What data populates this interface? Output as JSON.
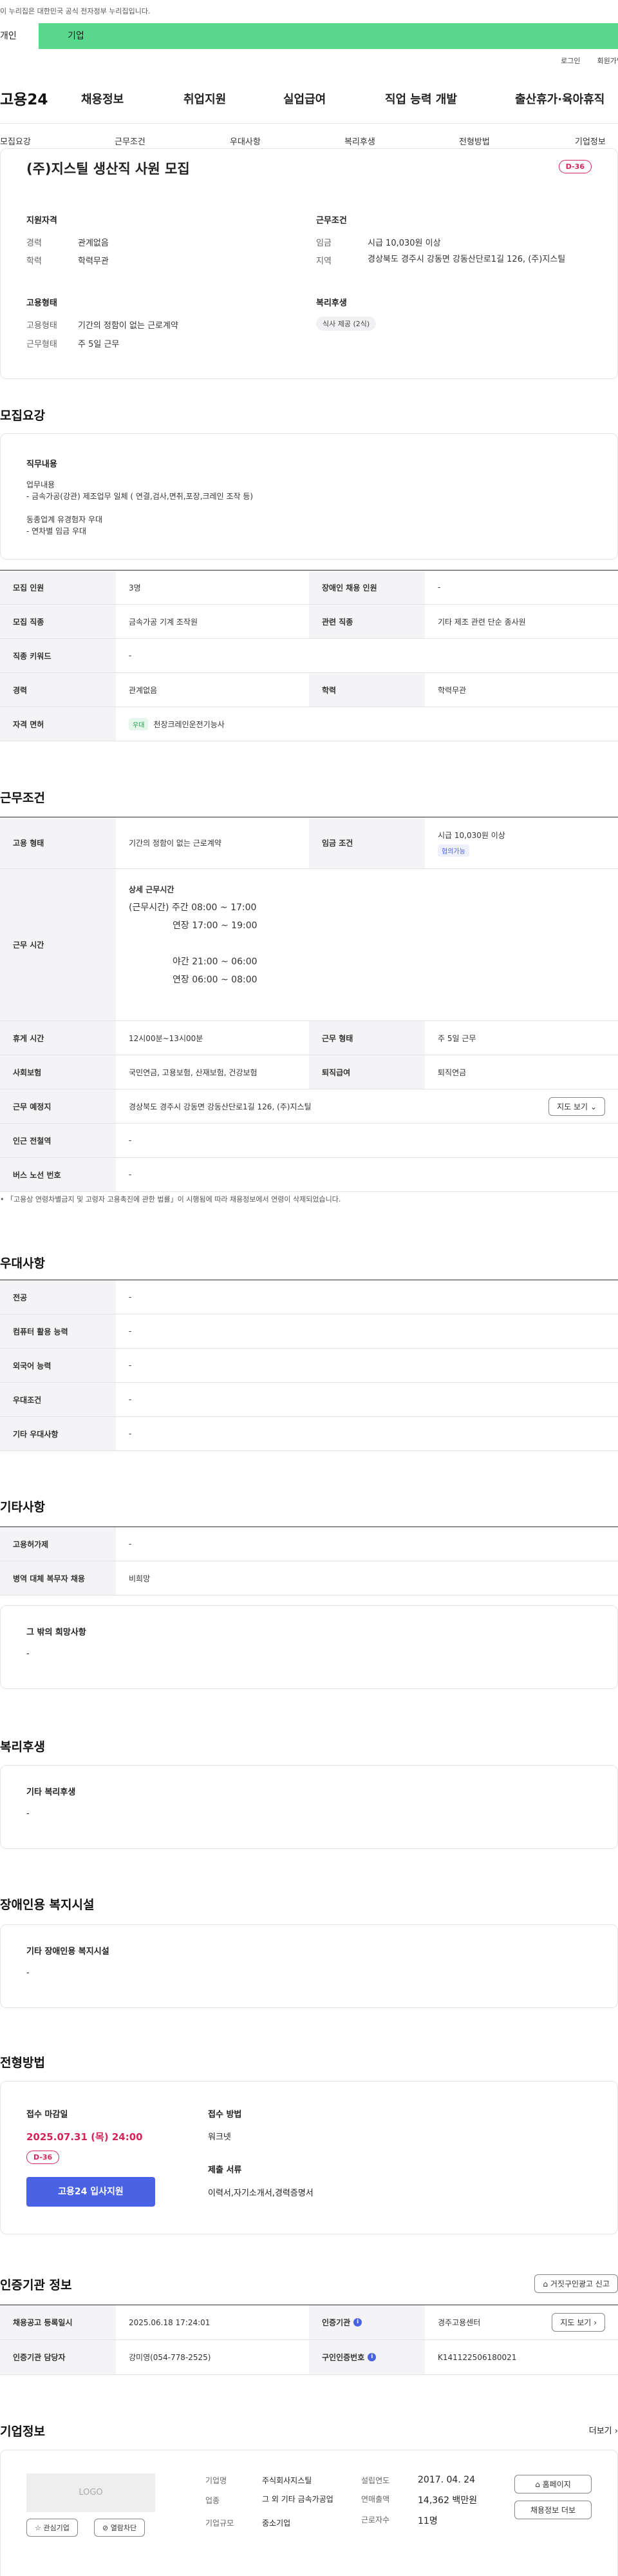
{
  "gov_banner": "이 누리집은 대한민국 공식 전자정부 누리집입니다.",
  "top_tabs": [
    "개인",
    "기업"
  ],
  "util": [
    "로그인",
    "회원가입"
  ],
  "logo": "고용24",
  "gnb": [
    "채용정보",
    "취업지원",
    "실업급여",
    "직업 능력 개발",
    "출산휴가·육아휴직"
  ],
  "subnav": [
    "모집요강",
    "근무조건",
    "우대사항",
    "복리후생",
    "전형방법",
    "기업정보"
  ],
  "summary": {
    "title": "(주)지스틸 생산직 사원 모집",
    "dday": "D-36",
    "qual_title": "지원자격",
    "qual": [
      {
        "k": "경력",
        "v": "관계없음"
      },
      {
        "k": "학력",
        "v": "학력무관"
      }
    ],
    "cond_title": "근무조건",
    "cond": [
      {
        "k": "임금",
        "v": "시급 10,030원 이상"
      },
      {
        "k": "지역",
        "v": "경상북도 경주시 강동면 강동산단로1길 126, (주)지스틸"
      }
    ],
    "emp_title": "고용형태",
    "emp": [
      {
        "k": "고용형태",
        "v": "기간의 정함이 없는 근로계약"
      },
      {
        "k": "근무형태",
        "v": "주 5일 근무"
      }
    ],
    "welfare_title": "복리후생",
    "welfare_tag": "식사 제공 (2식)"
  },
  "recruit": {
    "title": "모집요강",
    "duty_label": "직무내용",
    "duty_text": [
      "업무내용",
      "- 금속가공(강관) 제조업무 일체 ( 연결,검사,면취,포장,크레인 조작 등)",
      "",
      "동종업계 유경험자 우대",
      "- 연차별 임금 우대"
    ],
    "rows": [
      {
        "k": "모집 인원",
        "v": "3명",
        "k2": "장애인 채용 인원",
        "v2": "-"
      },
      {
        "k": "모집 직종",
        "v": "금속가공 기계 조작원",
        "k2": "관련 직종",
        "v2": "기타 제조 관련 단순 종사원"
      },
      {
        "k": "직종 키워드",
        "v": "-"
      },
      {
        "k": "경력",
        "v": "관계없음",
        "k2": "학력",
        "v2": "학력무관"
      },
      {
        "k": "자격 면허",
        "tag": "우대",
        "v": "천장크레인운전기능사"
      }
    ]
  },
  "work": {
    "title": "근무조건",
    "emp_k": "고용 형태",
    "emp_v": "기간의 정함이 없는 근로계약",
    "wage_k": "임금 조건",
    "wage_v": "시급 10,030원 이상",
    "wage_tag": "협의가능",
    "time_k": "근무 시간",
    "time_lines": [
      "상세 근무시간",
      "(근무시간) 주간 08:00 ~ 17:00",
      "연장 17:00 ~ 19:00",
      "",
      "야간 21:00 ~ 06:00",
      "연장 06:00 ~ 08:00"
    ],
    "break_k": "휴게 시간",
    "break_v": "12시00분~13시00분",
    "type_k": "근무 형태",
    "type_v": "주 5일 근무",
    "ins_k": "사회보험",
    "ins_v": "국민연금, 고용보험, 산재보험, 건강보험",
    "ret_k": "퇴직급여",
    "ret_v": "퇴직연금",
    "addr_k": "근무 예정지",
    "addr_v": "경상북도 경주시 강동면 강동산단로1길 126, (주)지스틸",
    "map_btn": "지도 보기",
    "subway_k": "인근 전철역",
    "subway_v": "-",
    "bus_k": "버스 노선 번호",
    "bus_v": "-",
    "note": "「고용상 연령차별금지 및 고령자 고용촉진에 관한 법률」이 시행됨에 따라 채용정보에서 연령이 삭제되었습니다."
  },
  "pref": {
    "title": "우대사항",
    "rows": [
      {
        "k": "전공",
        "v": "-"
      },
      {
        "k": "컴퓨터 활용 능력",
        "v": "-"
      },
      {
        "k": "외국어 능력",
        "v": "-"
      },
      {
        "k": "우대조건",
        "v": "-"
      },
      {
        "k": "기타 우대사항",
        "v": "-"
      }
    ]
  },
  "etc": {
    "title": "기타사항",
    "rows": [
      {
        "k": "고용허가제",
        "v": "-"
      },
      {
        "k": "병역 대체 복무자 채용",
        "v": "비희망"
      }
    ],
    "other_title": "그 밖의 희망사항",
    "other_v": "-"
  },
  "benefit": {
    "title": "복리후생",
    "label": "기타 복리후생",
    "v": "-"
  },
  "disabled": {
    "title": "장애인용 복지시설",
    "label": "기타 장애인용 복지시설",
    "v": "-"
  },
  "apply": {
    "title": "전형방법",
    "deadline_label": "접수 마감일",
    "deadline": "2025.07.31 (목) 24:00",
    "dday": "D-36",
    "apply_btn": "고용24 입사지원",
    "method_label": "접수 방법",
    "method": "워크넷",
    "docs_label": "제출 서류",
    "docs": "이력서,자기소개서,경력증명서"
  },
  "agency": {
    "title": "인증기관 정보",
    "report_btn": "거짓구인광고 신고",
    "reg_k": "채용공고 등록일시",
    "reg_v": "2025.06.18 17:24:01",
    "org_k": "인증기관",
    "org_v": "경주고용센터",
    "map_btn": "지도 보기",
    "mgr_k": "인증기관 담당자",
    "mgr_v": "강미영(054-778-2525)",
    "no_k": "구인인증번호",
    "no_v": "K141122506180021"
  },
  "company": {
    "title": "기업정보",
    "more": "더보기",
    "logo": "LOGO",
    "fav": "관심기업",
    "block": "열람차단",
    "info": [
      {
        "k": "기업명",
        "v": "주식회사지스틸"
      },
      {
        "k": "업종",
        "v": "그 외 기타 금속가공업"
      },
      {
        "k": "기업규모",
        "v": "중소기업"
      }
    ],
    "info2": [
      {
        "k": "설립연도",
        "v": "2017. 04. 24"
      },
      {
        "k": "연매출액",
        "v": "14,362 백만원"
      },
      {
        "k": "근로자수",
        "v": "11명"
      }
    ],
    "home_btn": "홈페이지",
    "jobs_btn": "채용정보 더보"
  },
  "colors": {
    "accent": "#4a63e4",
    "dday": "#d4245a",
    "tab_green": "#5ad68d"
  }
}
